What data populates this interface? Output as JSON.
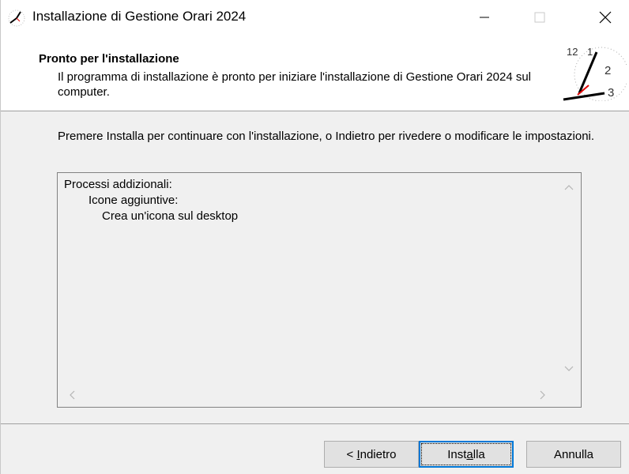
{
  "window": {
    "title": "Installazione di Gestione Orari 2024"
  },
  "header": {
    "title": "Pronto per l'installazione",
    "subtitle": "Il programma di installazione è pronto per iniziare l'installazione di Gestione Orari 2024 sul computer."
  },
  "clock_numbers": [
    "12",
    "1",
    "2",
    "3"
  ],
  "main": {
    "intro": "Premere Installa per continuare con l'installazione, o Indietro per rivedere o modificare le impostazioni.",
    "memo_lines": [
      "Processi addizionali:",
      "Icone aggiuntive:",
      "Crea un'icona sul desktop"
    ]
  },
  "buttons": {
    "back_prefix": "< ",
    "back_mnemonic": "I",
    "back_rest": "ndietro",
    "install_prefix": "Inst",
    "install_mnemonic": "a",
    "install_rest": "lla",
    "cancel": "Annulla"
  },
  "colors": {
    "focus_border": "#0078d7",
    "clock_hand_accent": "#e00000"
  }
}
